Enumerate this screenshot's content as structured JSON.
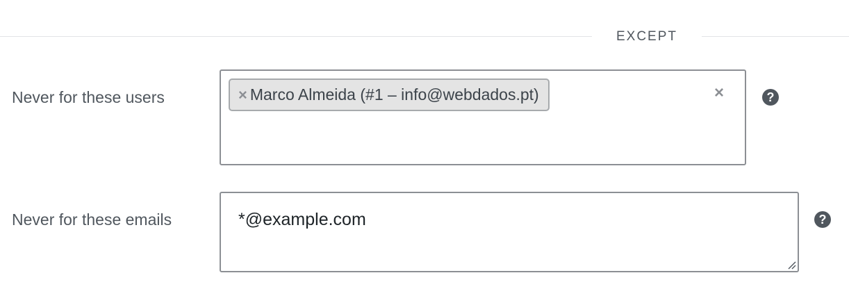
{
  "section": {
    "title": "EXCEPT"
  },
  "users_field": {
    "label": "Never for these users",
    "selected": [
      {
        "label": "Marco Almeida (#1 – info@webdados.pt)",
        "remove_glyph": "×"
      }
    ],
    "clear_glyph": "×",
    "help_glyph": "?"
  },
  "emails_field": {
    "label": "Never for these emails",
    "value": "*@example.com",
    "help_glyph": "?"
  },
  "icons": {
    "token_remove": "close-icon",
    "clear_all": "close-icon",
    "help": "question-circle-icon",
    "resize": "resize-grip-icon"
  },
  "colors": {
    "help_icon_bg": "#50575e",
    "border": "#8c8f94",
    "token_bg": "#e4e4e4"
  }
}
